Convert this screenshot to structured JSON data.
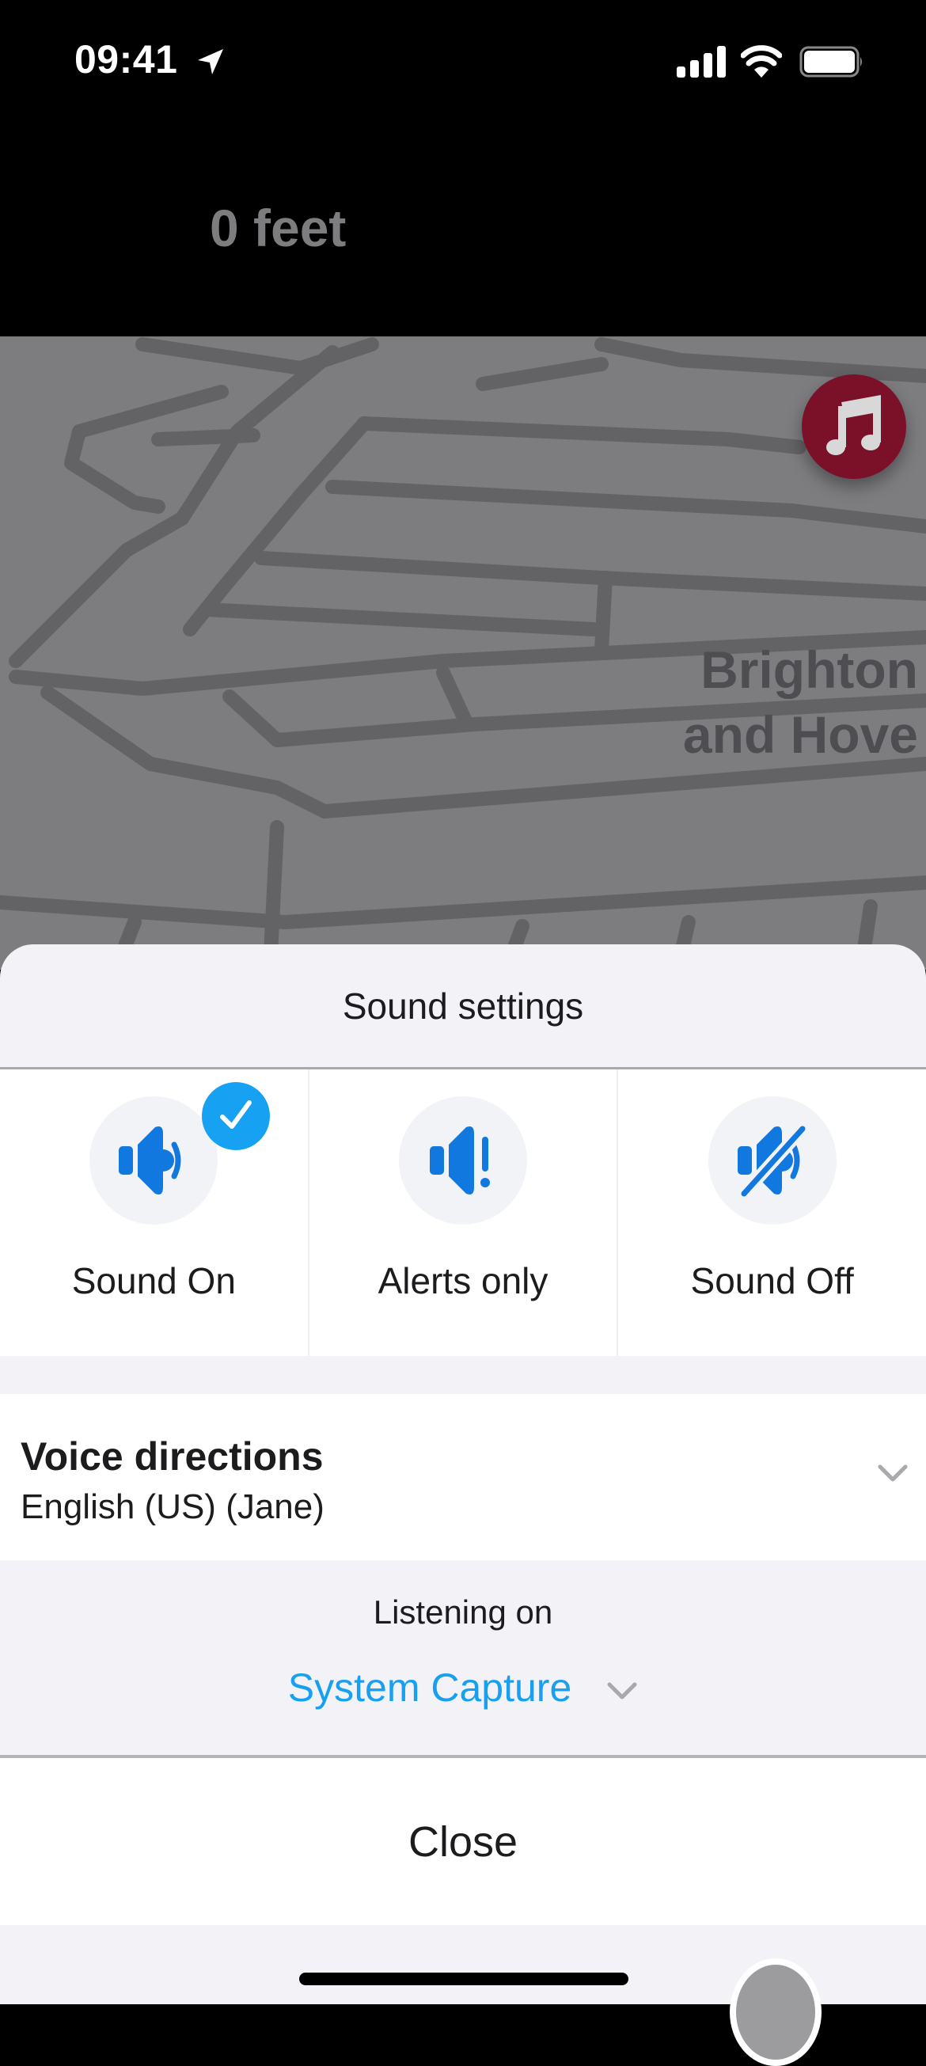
{
  "status_bar": {
    "time": "09:41",
    "location_icon": "location-arrow-icon",
    "signal_icon": "cellular-signal-icon",
    "wifi_icon": "wifi-icon",
    "battery_icon": "battery-icon"
  },
  "navigation": {
    "distance": "0 feet"
  },
  "map": {
    "city_label_line1": "Brighton",
    "city_label_line2": "and Hove",
    "music_button_icon": "music-note-icon",
    "music_button_color": "#7a1128"
  },
  "sheet": {
    "title": "Sound settings",
    "options": [
      {
        "label": "Sound On",
        "icon": "speaker-on-icon",
        "selected": true
      },
      {
        "label": "Alerts only",
        "icon": "speaker-alert-icon",
        "selected": false
      },
      {
        "label": "Sound Off",
        "icon": "speaker-muted-icon",
        "selected": false
      }
    ],
    "voice_directions": {
      "title": "Voice directions",
      "value": "English (US) (Jane)"
    },
    "listening": {
      "label": "Listening on",
      "device": "System Capture"
    },
    "close_label": "Close"
  },
  "colors": {
    "accent_blue": "#16a1f3",
    "icon_blue": "#1178e0",
    "link_blue": "#18a0f0"
  }
}
